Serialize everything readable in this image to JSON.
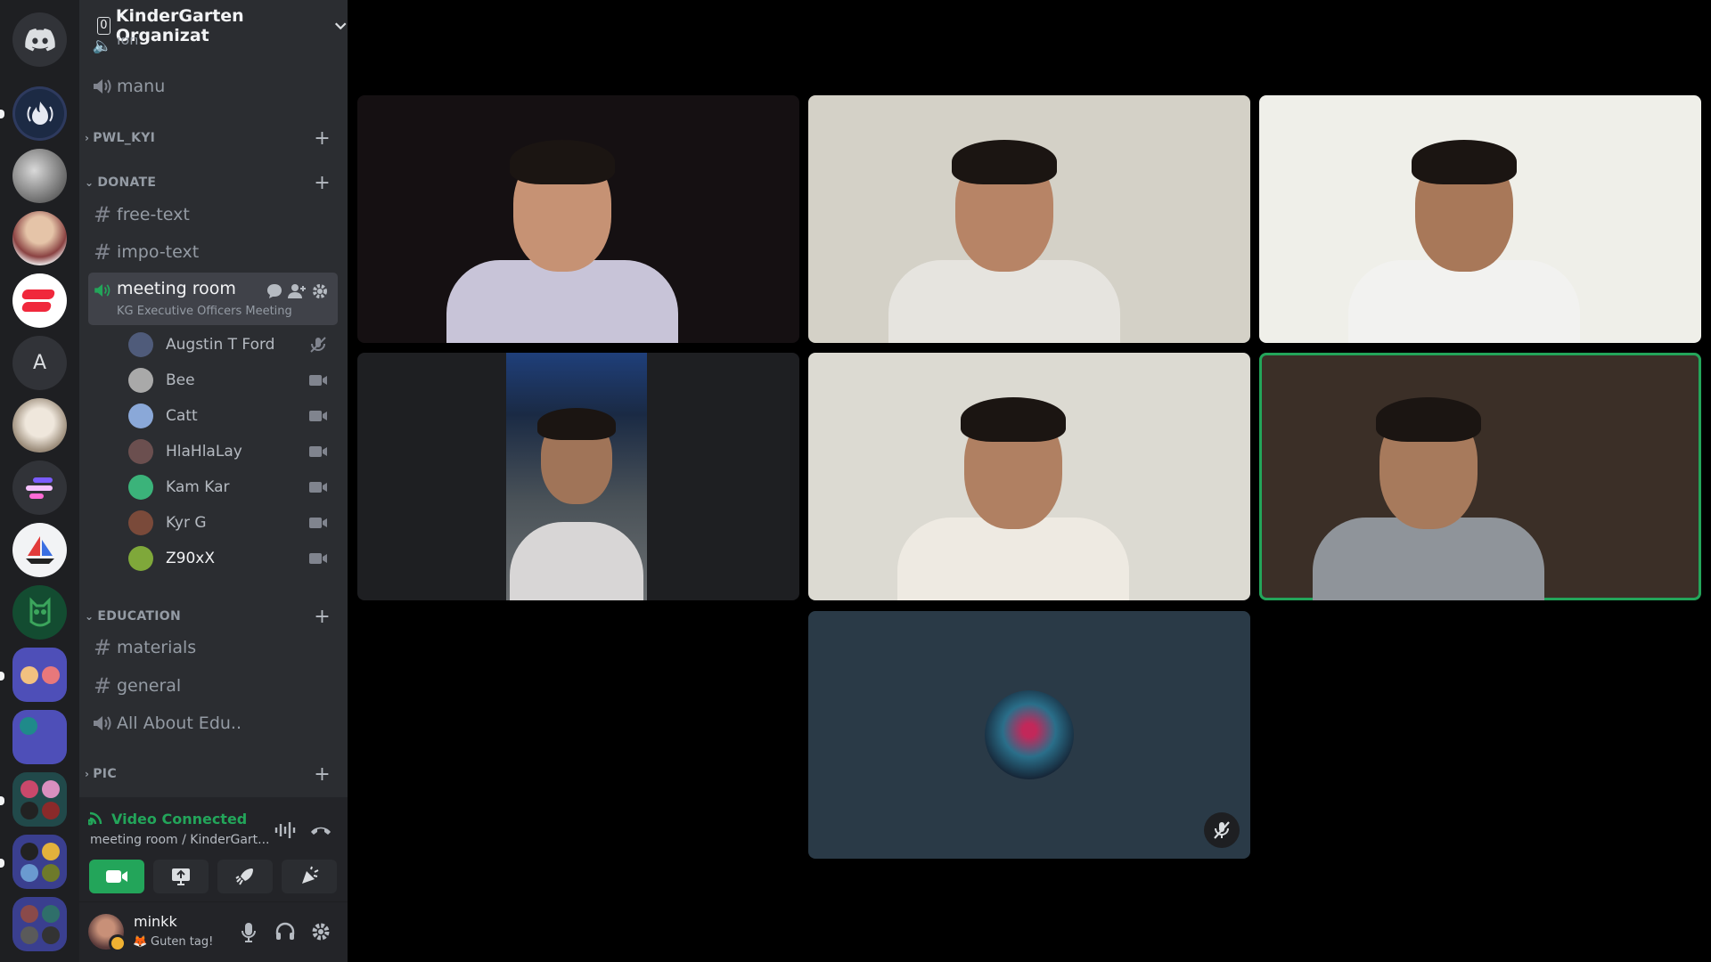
{
  "rail": {
    "servers": [
      {
        "name": "discord-home",
        "color": "#313338"
      },
      {
        "name": "server-fire",
        "color": "#1c2a44"
      },
      {
        "name": "server-cat",
        "color": "#5b5b5b"
      },
      {
        "name": "server-person",
        "color": "#c9b7a4"
      },
      {
        "name": "server-red",
        "color": "#ffffff"
      },
      {
        "name": "server-a",
        "color": "#313338",
        "letter": "A"
      },
      {
        "name": "server-pet",
        "color": "#8f8477"
      },
      {
        "name": "server-lines",
        "color": "#313338"
      },
      {
        "name": "server-boat",
        "color": "#f2f3f5"
      },
      {
        "name": "server-owl",
        "color": "#134c31"
      },
      {
        "name": "folder-1",
        "color": "#4e4fb8"
      },
      {
        "name": "folder-2",
        "color": "#4e4fb8"
      },
      {
        "name": "folder-3",
        "color": "#21494a"
      },
      {
        "name": "folder-4",
        "color": "#3a3f8f"
      },
      {
        "name": "folder-5",
        "color": "#3a3f8f"
      }
    ]
  },
  "guild": {
    "name": "KinderGarten Organizat",
    "badge": "0"
  },
  "channels": {
    "top_partial": "lon",
    "manu": "manu",
    "cat_pwl": "PWL_KYI",
    "cat_donate": "DONATE",
    "free_text": "free-text",
    "impo_text": "impo-text",
    "meeting_room": "meeting room",
    "meeting_status": "KG Executive Officers Meeting",
    "cat_education": "EDUCATION",
    "materials": "materials",
    "general": "general",
    "all_about_edu": "All About Edu..",
    "cat_pic": "PIC"
  },
  "members": [
    {
      "name": "Augstin T Ford",
      "status": "muted",
      "avatar": "#4f5b7a"
    },
    {
      "name": "Bee",
      "status": "video",
      "avatar": "#a9a9a9"
    },
    {
      "name": "Catt",
      "status": "video",
      "avatar": "#8aa8d8"
    },
    {
      "name": "HlaHlaLay",
      "status": "video",
      "avatar": "#6b4f4f"
    },
    {
      "name": "Kam Kar",
      "status": "video",
      "avatar": "#3bb37a"
    },
    {
      "name": "Kyr G",
      "status": "video",
      "avatar": "#7a4a3a"
    },
    {
      "name": "Z90xX",
      "status": "video",
      "avatar": "#7fa83a"
    }
  ],
  "voice": {
    "status": "Video Connected",
    "location": "meeting room / KinderGart...",
    "accent": "#23a55a"
  },
  "user": {
    "name": "minkk",
    "status": "Guten tag!",
    "status_emoji": "🦊"
  },
  "video_tiles": [
    {
      "name": "tile-1",
      "bg": "#151012",
      "skin": "#c69274",
      "shirt": "#c8c4d8",
      "speaking": false
    },
    {
      "name": "tile-2",
      "bg": "#d4d1c7",
      "skin": "#b78466",
      "shirt": "#e6e4df",
      "speaking": false
    },
    {
      "name": "tile-3",
      "bg": "#efefe9",
      "skin": "#a87859",
      "shirt": "#f2f2f0",
      "speaking": false
    },
    {
      "name": "tile-4",
      "bg": "#1e1f22",
      "skin": "#a07458",
      "shirt": "#d8d6d6",
      "speaking": false
    },
    {
      "name": "tile-5",
      "bg": "#dcdad2",
      "skin": "#b08062",
      "shirt": "#eeeae2",
      "speaking": false
    },
    {
      "name": "tile-6",
      "bg": "#3b2f27",
      "skin": "#a77a5c",
      "shirt": "#8f949a",
      "speaking": true
    },
    {
      "name": "tile-7",
      "bg": "#2a3a47",
      "skin": "",
      "shirt": "",
      "speaking": false
    }
  ]
}
